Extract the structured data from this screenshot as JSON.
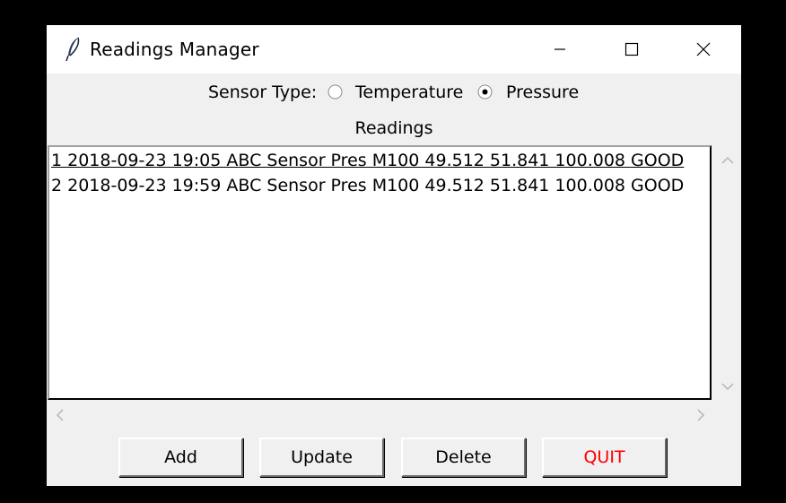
{
  "window": {
    "title": "Readings Manager",
    "icon": "feather-icon"
  },
  "sensor": {
    "label": "Sensor Type:",
    "options": [
      {
        "label": "Temperature",
        "selected": false
      },
      {
        "label": "Pressure",
        "selected": true
      }
    ]
  },
  "readings": {
    "label": "Readings",
    "items": [
      "1 2018-09-23 19:05 ABC Sensor Pres M100 49.512 51.841 100.008 GOOD",
      "2 2018-09-23 19:59 ABC Sensor Pres M100 49.512 51.841 100.008 GOOD"
    ]
  },
  "buttons": {
    "add": "Add",
    "update": "Update",
    "delete": "Delete",
    "quit": "QUIT"
  },
  "colors": {
    "quit_text": "#ff0000"
  }
}
